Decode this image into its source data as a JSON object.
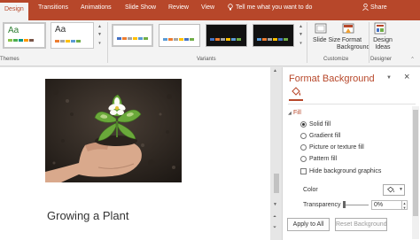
{
  "tabs": [
    {
      "label": "Design",
      "active": true
    },
    {
      "label": "Transitions"
    },
    {
      "label": "Animations"
    },
    {
      "label": "Slide Show"
    },
    {
      "label": "Review"
    },
    {
      "label": "View"
    }
  ],
  "tell_me": "Tell me what you want to do",
  "share": "Share",
  "ribbon": {
    "themes_group": "Themes",
    "variants_group": "Variants",
    "customize_group": "Customize",
    "designer_group": "Designer",
    "theme_sample_text": "Aa",
    "slide_size_label": "Slide Size",
    "format_bg_label": "Format Background",
    "design_ideas_label": "Design Ideas"
  },
  "slide": {
    "title": "Growing a Plant"
  },
  "pane": {
    "title": "Format Background",
    "section": "Fill",
    "options": [
      "Solid fill",
      "Gradient fill",
      "Picture or texture fill",
      "Pattern fill"
    ],
    "selected_option": "Solid fill",
    "hide_graphics": "Hide background graphics",
    "color_label": "Color",
    "transparency_label": "Transparency",
    "transparency_value": "0%",
    "apply_all": "Apply to All",
    "reset": "Reset Background"
  },
  "colors": {
    "accent": "#b7472a"
  }
}
